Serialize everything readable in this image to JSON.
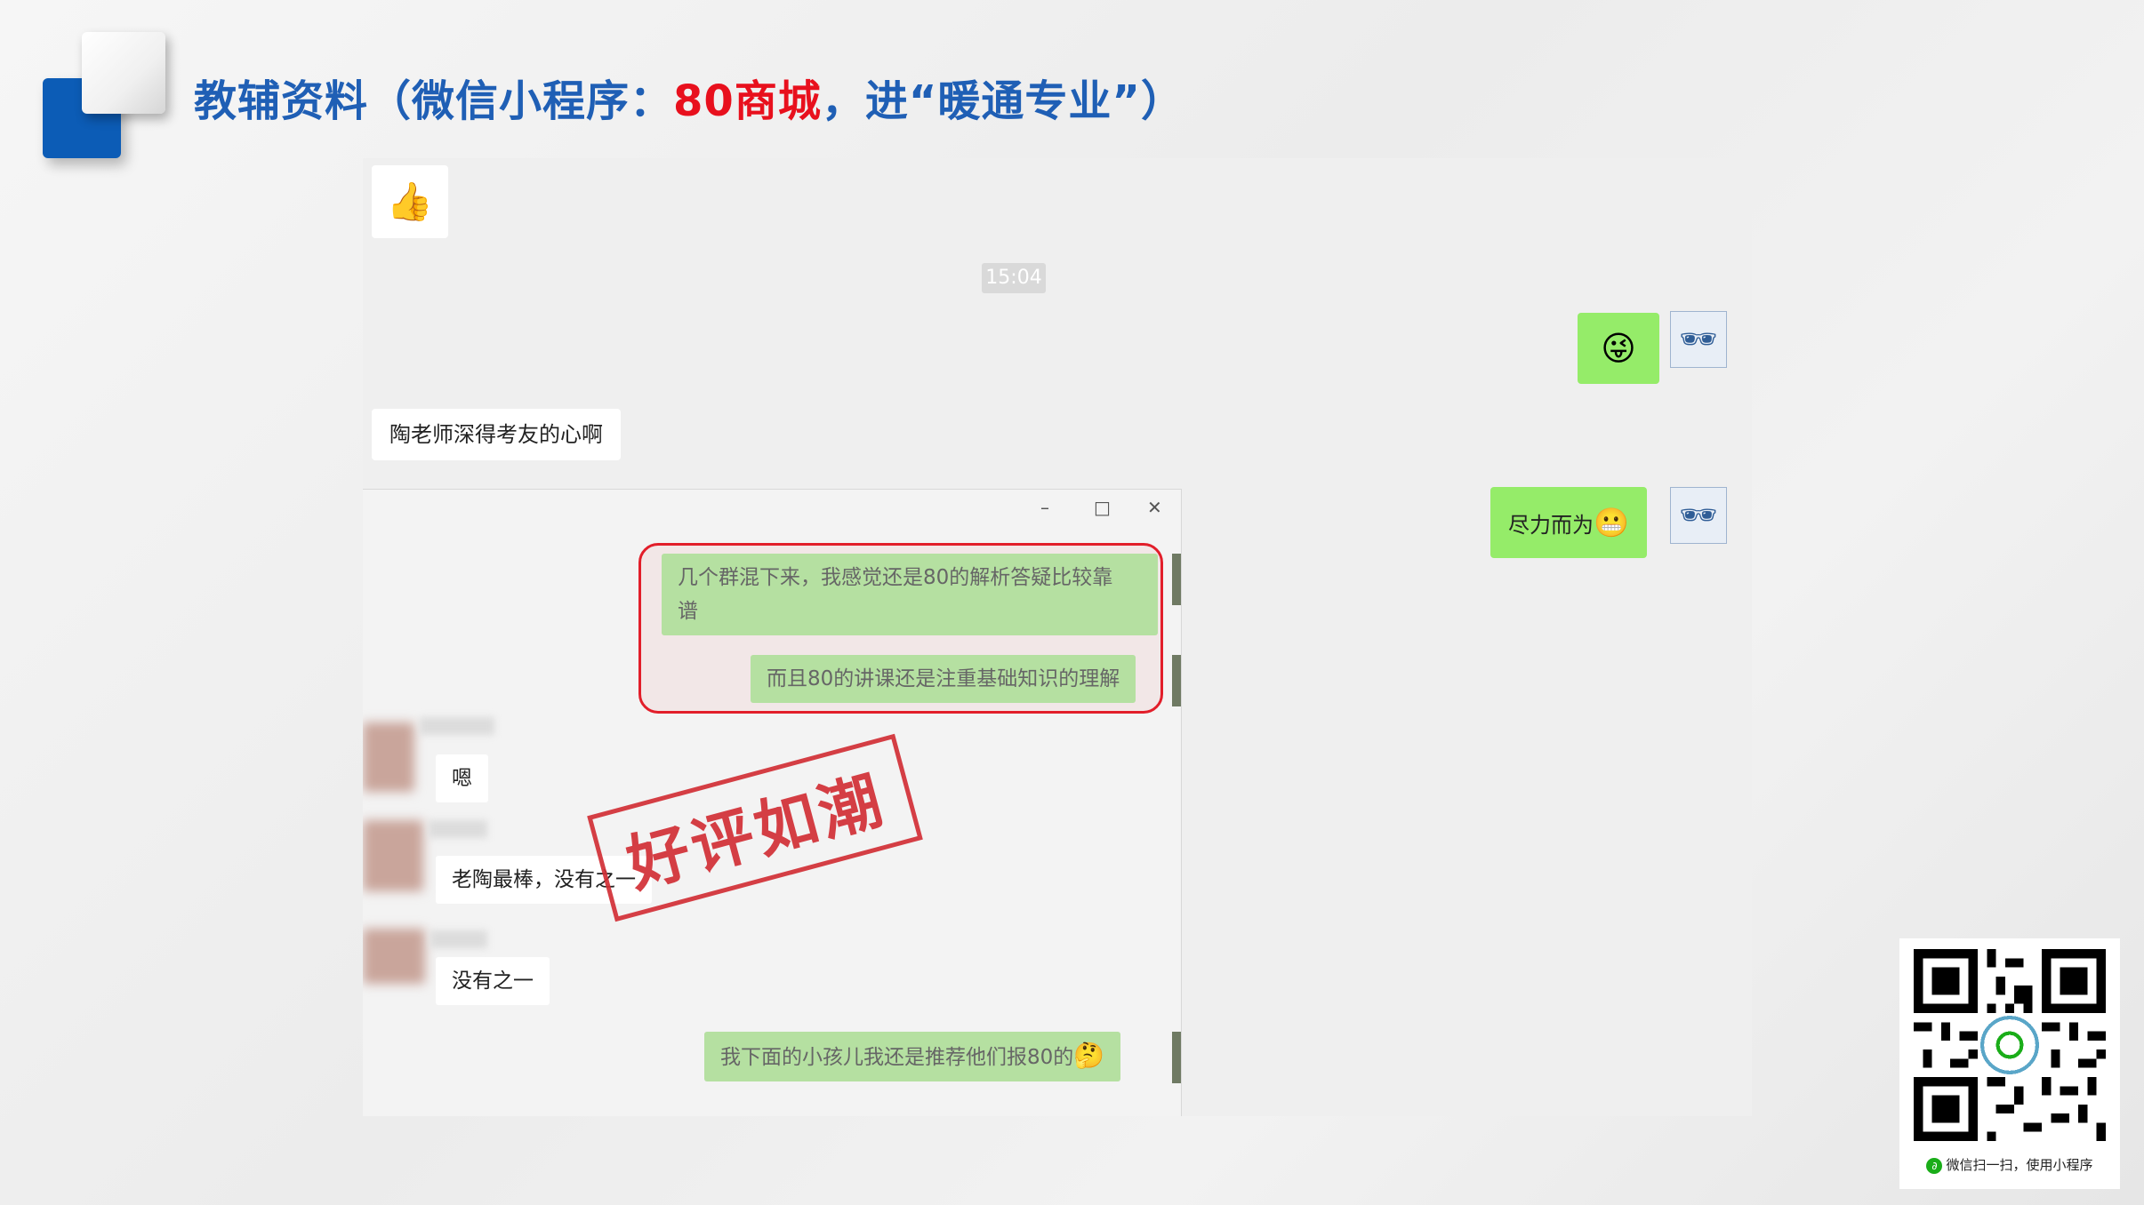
{
  "header": {
    "title_part1": "教辅资料（微信小程序：",
    "title_red": "80商城",
    "title_part2": "，进“暖通专业”）"
  },
  "chat": {
    "thumbs_emoji": "👍",
    "time": "15:04",
    "my_emoji_1": "😜",
    "my_avatar_icon": "🕶",
    "msg_other_1": "陶老师深得考友的心啊",
    "msg_me_2": "尽力而为",
    "msg_me_2_emoji": "😬"
  },
  "inner_window": {
    "controls": {
      "minimize": "–",
      "maximize": "□",
      "close": "✕"
    },
    "green_msg_1": "几个群混下来，我感觉还是80的解析答疑比较靠",
    "green_msg_1_line2": "谱",
    "green_msg_2": "而且80的讲课还是注重基础知识的理解",
    "white_msg_1": "嗯",
    "white_msg_2": "老陶最棒，没有之一",
    "white_msg_3": "没有之一",
    "green_msg_3": "我下面的小孩儿我还是推荐他们报80的",
    "green_msg_3_emoji": "🤔"
  },
  "stamp": {
    "text": "好评如潮",
    "color": "#d22f36"
  },
  "qr": {
    "caption": "微信扫一扫，使用小程序"
  },
  "colors": {
    "brand_blue": "#1f5fb5",
    "accent_red": "#e8101d",
    "wechat_green": "#95ec69"
  }
}
